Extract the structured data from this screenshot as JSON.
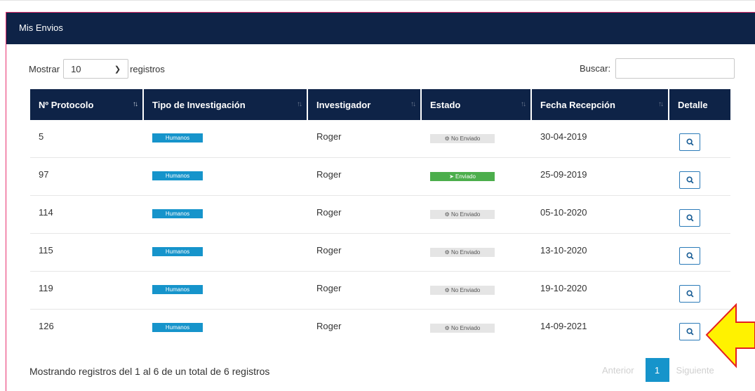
{
  "panel": {
    "title": "Mis Envios"
  },
  "length": {
    "prefix": "Mostrar",
    "value": "10",
    "suffix": "registros"
  },
  "search": {
    "label": "Buscar:",
    "placeholder": ""
  },
  "table": {
    "headers": [
      "Nº Protocolo",
      "Tipo de Investigación",
      "Investigador",
      "Estado",
      "Fecha Recepción",
      "Detalle"
    ],
    "rows": [
      {
        "protocolo": "5",
        "tipo": "Humanos",
        "investigador": "Roger",
        "estado": "No Enviado",
        "fecha": "30-04-2019"
      },
      {
        "protocolo": "97",
        "tipo": "Humanos",
        "investigador": "Roger",
        "estado": "Enviado",
        "fecha": "25-09-2019"
      },
      {
        "protocolo": "114",
        "tipo": "Humanos",
        "investigador": "Roger",
        "estado": "No Enviado",
        "fecha": "05-10-2020"
      },
      {
        "protocolo": "115",
        "tipo": "Humanos",
        "investigador": "Roger",
        "estado": "No Enviado",
        "fecha": "13-10-2020"
      },
      {
        "protocolo": "119",
        "tipo": "Humanos",
        "investigador": "Roger",
        "estado": "No Enviado",
        "fecha": "19-10-2020"
      },
      {
        "protocolo": "126",
        "tipo": "Humanos",
        "investigador": "Roger",
        "estado": "No Enviado",
        "fecha": "14-09-2021"
      }
    ]
  },
  "footer": {
    "info": "Mostrando registros del 1 al 6 de un total de 6 registros",
    "prev": "Anterior",
    "page": "1",
    "next": "Siguiente"
  },
  "icons": {
    "detail": "search-icon",
    "no_enviado": "gears-icon",
    "enviado": "paper-plane-icon",
    "annotation": "arrow-left-icon"
  },
  "colors": {
    "header_bg": "#0e2347",
    "panel_border": "#e8306f",
    "badge_type": "#1694cb",
    "badge_enviado": "#4cae4c",
    "badge_no_enviado": "#e5e5e5",
    "annotation_arrow": "#fff200"
  }
}
